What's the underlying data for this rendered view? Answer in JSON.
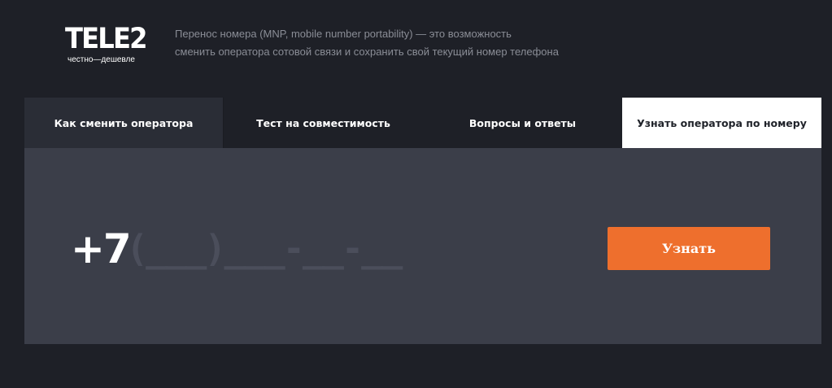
{
  "header": {
    "logo_text": "TELE2",
    "logo_tagline": "честно—дешевле",
    "description_line1": "Перенос номера (MNP, mobile number portability) — это возможность",
    "description_line2": "сменить оператора сотовой связи и сохранить свой текущий номер телефона"
  },
  "tabs": [
    {
      "label": "Как сменить оператора"
    },
    {
      "label": "Тест на совместимость"
    },
    {
      "label": "Вопросы и ответы"
    },
    {
      "label": "Узнать оператора по номеру",
      "active": true
    }
  ],
  "lookup": {
    "phone_prefix": "+7",
    "phone_placeholder": "(___)___-__-__",
    "submit_label": "Узнать"
  },
  "colors": {
    "background": "#1e2027",
    "panel": "#3b3e49",
    "accent": "#ee6f2d",
    "active_tab": "#ffffff"
  }
}
